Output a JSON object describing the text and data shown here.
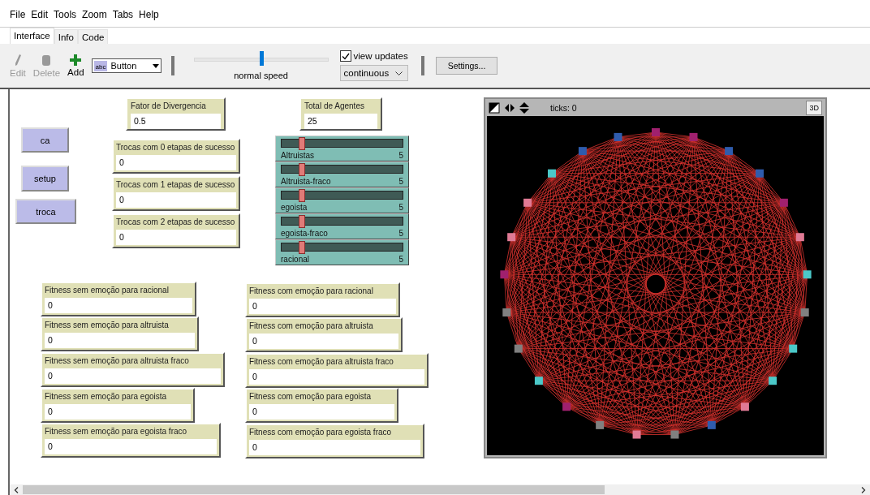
{
  "menu": [
    "File",
    "Edit",
    "Tools",
    "Zoom",
    "Tabs",
    "Help"
  ],
  "tabs": [
    {
      "label": "Interface",
      "selected": true
    },
    {
      "label": "Info",
      "selected": false
    },
    {
      "label": "Code",
      "selected": false
    }
  ],
  "toolbar": {
    "tools": [
      {
        "kind": "edit",
        "label": "Edit",
        "disabled": true
      },
      {
        "kind": "delete",
        "label": "Delete",
        "disabled": true
      },
      {
        "kind": "add",
        "label": "Add",
        "disabled": false
      }
    ],
    "widget_chooser": {
      "icon_text": "abc",
      "value": "Button"
    },
    "speed": {
      "label": "normal speed",
      "level": 0.5
    },
    "view_updates": {
      "label": "view updates",
      "checked": true
    },
    "update_mode": "continuous",
    "settings": "Settings..."
  },
  "buttons": [
    {
      "label": "ca"
    },
    {
      "label": "setup"
    },
    {
      "label": "troca"
    }
  ],
  "inputs": [
    {
      "label": "Fator de Divergencia",
      "value": "0.5"
    },
    {
      "label": "Total de Agentes",
      "value": "25"
    }
  ],
  "monitors": [
    {
      "label": "Trocas com 0 etapas de sucesso",
      "value": "0"
    },
    {
      "label": "Trocas com 1 etapas de sucesso",
      "value": "0"
    },
    {
      "label": "Trocas com 2 etapas de sucesso",
      "value": "0"
    },
    {
      "label": "Fitness sem emoção para racional",
      "value": "0"
    },
    {
      "label": "Fitness sem emoção para altruista",
      "value": "0"
    },
    {
      "label": "Fitness sem emoção para altruista fraco",
      "value": "0"
    },
    {
      "label": "Fitness sem emoção para egoista",
      "value": "0"
    },
    {
      "label": "Fitness sem emoção para egoista fraco",
      "value": "0"
    },
    {
      "label": "Fitness com emoção para racional",
      "value": "0"
    },
    {
      "label": "Fitness com emoção para altruista",
      "value": "0"
    },
    {
      "label": "Fitness com emoção para altruista fraco",
      "value": "0"
    },
    {
      "label": "Fitness com emoção para egoista",
      "value": "0"
    },
    {
      "label": "Fitness com emoção para egoista fraco",
      "value": "0"
    }
  ],
  "sliders": [
    {
      "label": "Altruistas",
      "value": "5",
      "level": 0.17
    },
    {
      "label": "Altruista-fraco",
      "value": "5",
      "level": 0.17
    },
    {
      "label": "egoista",
      "value": "5",
      "level": 0.17
    },
    {
      "label": "egoista-fraco",
      "value": "5",
      "level": 0.17
    },
    {
      "label": "racional",
      "value": "5",
      "level": 0.17
    }
  ],
  "view": {
    "ticks": "ticks: 0",
    "three_d": "3D"
  }
}
